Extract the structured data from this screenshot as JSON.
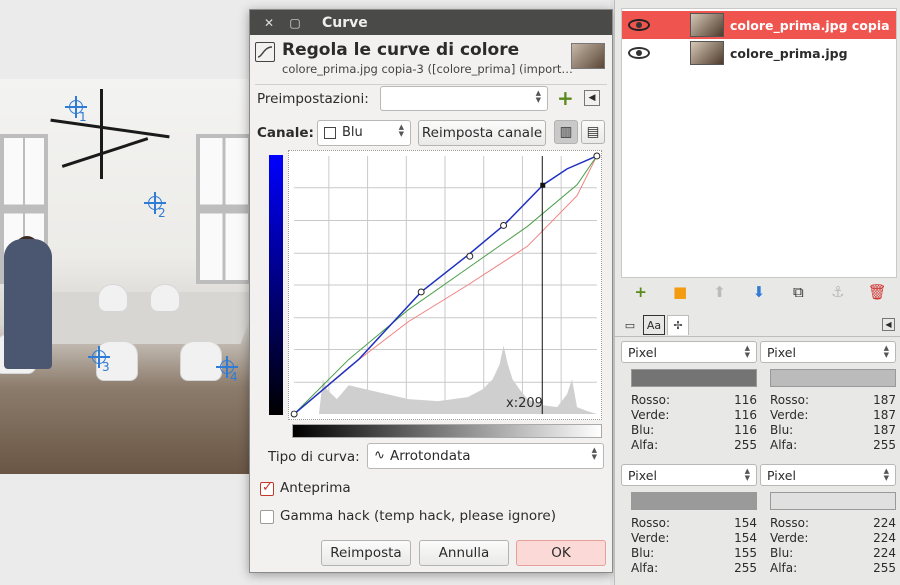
{
  "dialog": {
    "window_title": "Curve",
    "heading": "Regola le curve di colore",
    "subheading": "colore_prima.jpg copia-3 ([colore_prima] (import…",
    "presets_label": "Preimpostazioni:",
    "presets_value": "",
    "channel_label": "Canale:",
    "channel_value": "Blu",
    "reset_channel": "Reimposta canale",
    "cursor_readout": "x:209",
    "curve_type_label": "Tipo di curva:",
    "curve_type_value": "Arrotondata",
    "preview_label": "Anteprima",
    "preview_checked": true,
    "gamma_label": "Gamma hack (temp hack, please ignore)",
    "gamma_checked": false,
    "btn_reset": "Reimposta",
    "btn_cancel": "Annulla",
    "btn_ok": "OK",
    "close_icon": "close-icon",
    "accent": "#c0392b"
  },
  "canvas": {
    "markers": [
      "1",
      "2",
      "3",
      "4"
    ]
  },
  "layers": {
    "items": [
      {
        "name": "colore_prima.jpg copia",
        "selected": true
      },
      {
        "name": "colore_prima.jpg",
        "selected": false
      }
    ],
    "selected_color": "#f0544f"
  },
  "pointer": {
    "samplers": [
      {
        "unit": "Pixel",
        "swatch": "#747474",
        "labels": [
          "Rosso:",
          "Verde:",
          "Blu:",
          "Alfa:"
        ],
        "values": [
          "116",
          "116",
          "116",
          "255"
        ]
      },
      {
        "unit": "Pixel",
        "swatch": "#bbbbbb",
        "labels": [
          "Rosso:",
          "Verde:",
          "Blu:",
          "Alfa:"
        ],
        "values": [
          "187",
          "187",
          "187",
          "255"
        ]
      },
      {
        "unit": "Pixel",
        "swatch": "#9a9a9b",
        "labels": [
          "Rosso:",
          "Verde:",
          "Blu:",
          "Alfa:"
        ],
        "values": [
          "154",
          "154",
          "155",
          "255"
        ]
      },
      {
        "unit": "Pixel",
        "swatch": "#e0e0e0",
        "labels": [
          "Rosso:",
          "Verde:",
          "Blu:",
          "Alfa:"
        ],
        "values": [
          "224",
          "224",
          "224",
          "255"
        ]
      }
    ]
  }
}
